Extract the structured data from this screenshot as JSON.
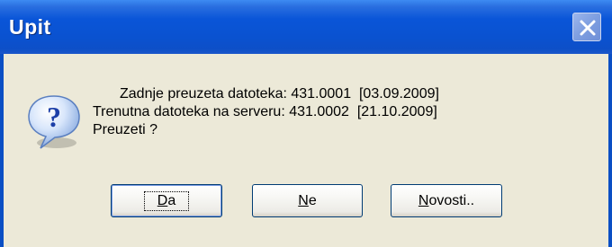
{
  "window": {
    "title": "Upit"
  },
  "icons": {
    "dialog_icon": "question-icon",
    "close_icon": "close-icon"
  },
  "message": {
    "line1": "Zadnje preuzeta datoteka: 431.0001  [03.09.2009]",
    "line2": "Trenutna datoteka na serveru: 431.0002  [21.10.2009]",
    "line3": "Preuzeti ?"
  },
  "buttons": {
    "yes": {
      "mnemonic": "D",
      "rest": "a"
    },
    "no": {
      "mnemonic": "N",
      "rest": "e"
    },
    "news": {
      "mnemonic": "N",
      "rest": "ovosti.."
    }
  },
  "colors": {
    "titlebar": "#0a55d8",
    "body": "#ece9d8",
    "button_border": "#003c74"
  }
}
